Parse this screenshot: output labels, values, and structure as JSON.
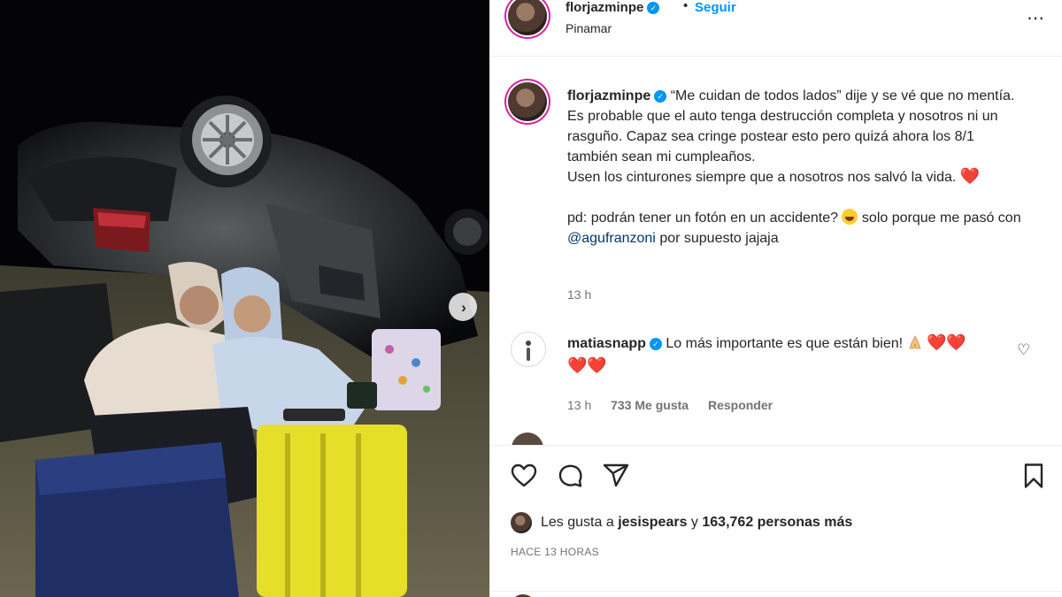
{
  "header": {
    "username": "florjazminpe",
    "separator": "•",
    "follow_label": "Seguir",
    "location": "Pinamar",
    "more_icon": "more-horizontal-icon"
  },
  "caption": {
    "username": "florjazminpe",
    "line1": "“Me cuidan de todos lados” dije y se vé que no mentía.",
    "line2": "Es probable que el auto tenga destrucción completa y nosotros ni un rasguño. Capaz sea cringe postear esto pero quizá ahora los 8/1 también sean mi cumpleaños.",
    "line3": "Usen los cinturones siempre que a nosotros nos salvó la vida.",
    "line3_emoji": "❤️",
    "line4_pre": "pd: podrán tener un fotón en un accidente?",
    "line4_mid": "solo porque me pasó con",
    "line4_mention": "@agufranzoni",
    "line4_post": "por supuesto jajaja",
    "time": "13 h"
  },
  "comment": {
    "username": "matiasnapp",
    "text": "Lo más importante es que están bien!",
    "hearts": "❤️❤️",
    "hearts2": "❤️❤️",
    "time": "13 h",
    "likes": "733 Me gusta",
    "reply": "Responder"
  },
  "actions": {
    "like_icon": "heart-icon",
    "comment_icon": "comment-icon",
    "share_icon": "share-icon",
    "save_icon": "bookmark-icon"
  },
  "likes": {
    "prefix": "Les gusta a",
    "user": "jesispears",
    "joiner": "y",
    "count": "163,762 personas más"
  },
  "posted_time": "HACE 13 HORAS",
  "colors": {
    "link": "#0095f6",
    "heart": "#e0245e",
    "muted": "#737373"
  }
}
